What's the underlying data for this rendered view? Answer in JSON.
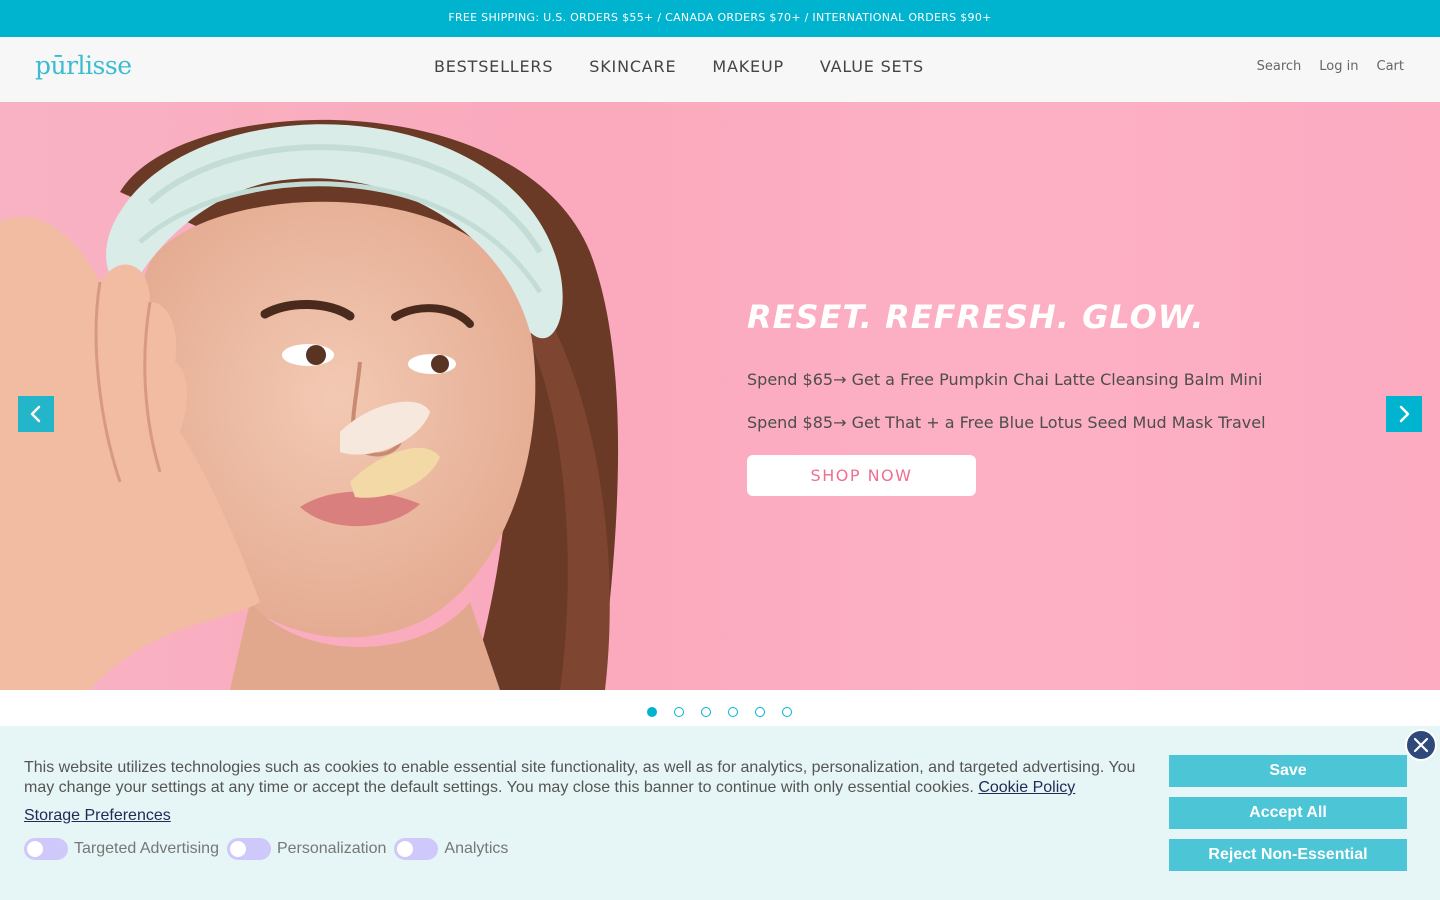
{
  "announcement": {
    "text": "FREE SHIPPING: U.S. ORDERS $55+ / CANADA ORDERS $70+ / INTERNATIONAL ORDERS $90+"
  },
  "header": {
    "logo": "pūrlisse",
    "nav": [
      "BESTSELLERS",
      "SKINCARE",
      "MAKEUP",
      "VALUE SETS"
    ],
    "utility": [
      "Search",
      "Log in",
      "Cart"
    ]
  },
  "hero": {
    "title": "RESET. REFRESH. GLOW.",
    "line1": "Spend $65→ Get a Free Pumpkin Chai Latte Cleansing Balm Mini",
    "line2": "Spend $85→ Get That + a Free Blue Lotus Seed Mud Mask Travel",
    "cta": "SHOP NOW",
    "prev_icon": "chevron-left-icon",
    "next_icon": "chevron-right-icon"
  },
  "carousel": {
    "slide_count": 6,
    "active_index": 0
  },
  "cookie_banner": {
    "text": "This website utilizes technologies such as cookies to enable essential site functionality, as well as for analytics, personalization, and targeted advertising. You may change your settings at any time or accept the default settings. You may close this banner to continue with only essential cookies.",
    "policy_link": "Cookie Policy",
    "storage_link": "Storage Preferences",
    "toggles": [
      {
        "label": "Targeted Advertising",
        "on": false
      },
      {
        "label": "Personalization",
        "on": false
      },
      {
        "label": "Analytics",
        "on": false
      }
    ],
    "buttons": {
      "save": "Save",
      "accept": "Accept All",
      "reject": "Reject Non-Essential"
    },
    "close_icon": "close-icon"
  },
  "colors": {
    "brand_teal": "#00b4d0",
    "hero_pink": "#fba9bd",
    "cta_pink": "#ee6f91",
    "banner_bg": "#e6f5f5",
    "button_teal": "#4cc5d6",
    "toggle_off": "#cfc9fb"
  }
}
